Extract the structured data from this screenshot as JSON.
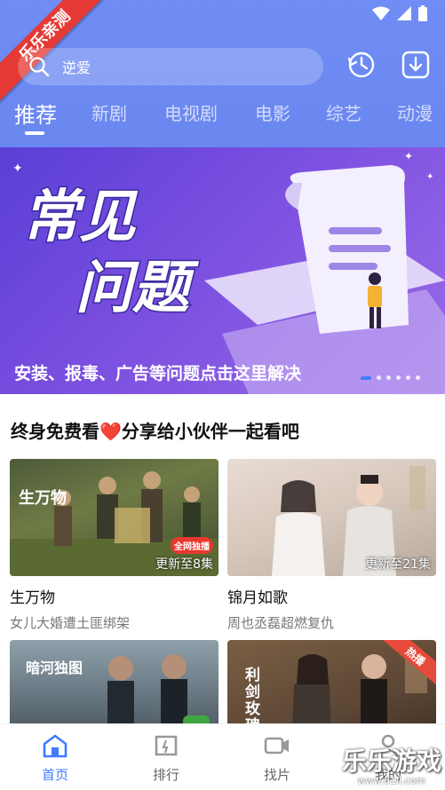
{
  "corner_ribbon": "乐乐亲测",
  "search": {
    "placeholder": "逆爱"
  },
  "tabs": [
    {
      "label": "推荐",
      "active": true
    },
    {
      "label": "新剧"
    },
    {
      "label": "电视剧"
    },
    {
      "label": "电影"
    },
    {
      "label": "综艺"
    },
    {
      "label": "动漫"
    }
  ],
  "banner": {
    "headline_1": "常见",
    "headline_2": "问题",
    "caption": "安装、报毒、广告等问题点击这里解决",
    "dot_count": 6,
    "active_dot": 0
  },
  "section": {
    "title": "终身免费看❤️分享给小伙伴一起看吧"
  },
  "cards": [
    {
      "title": "生万物",
      "subtitle": "女儿大婚遭土匪绑架",
      "update": "更新至8集",
      "poster_text": "生万物",
      "badge": "全网独播"
    },
    {
      "title": "锦月如歌",
      "subtitle": "周也丞磊超燃复仇",
      "update": "更新至21集",
      "poster_text": "",
      "badge": ""
    },
    {
      "title": "",
      "subtitle": "",
      "update": "",
      "poster_text": "暗河独图",
      "badge": ""
    },
    {
      "title": "",
      "subtitle": "",
      "update": "",
      "poster_text": "利剑玫瑰",
      "badge": "热播"
    }
  ],
  "tabbar": [
    {
      "label": "首页",
      "icon": "home-icon",
      "active": true
    },
    {
      "label": "排行",
      "icon": "ranking-icon"
    },
    {
      "label": "找片",
      "icon": "video-icon"
    },
    {
      "label": "我的",
      "icon": "user-icon"
    }
  ],
  "watermark": {
    "text": "乐乐游戏",
    "url": "www.61ll.com"
  },
  "colors": {
    "accent": "#3f7bff",
    "header": "#6f8df4",
    "ribbon": "#e53935"
  }
}
